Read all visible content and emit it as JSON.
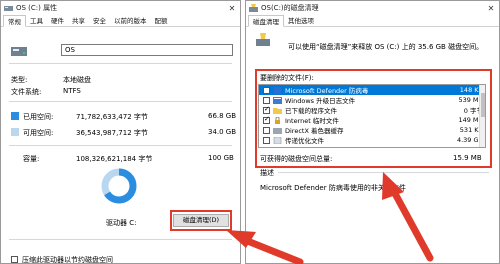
{
  "props": {
    "title": "OS (C:) 属性",
    "tabs": [
      "常规",
      "工具",
      "硬件",
      "共享",
      "安全",
      "以前的版本",
      "配额"
    ],
    "name": "OS",
    "type_label": "类型:",
    "type_value": "本地磁盘",
    "fs_label": "文件系统:",
    "fs_value": "NTFS",
    "used_label": "已用空间:",
    "used_bytes": "71,782,633,472 字节",
    "used_gb": "66.8 GB",
    "free_label": "可用空间:",
    "free_bytes": "36,543,987,712 字节",
    "free_gb": "34.0 GB",
    "cap_label": "容量:",
    "cap_bytes": "108,326,621,184 字节",
    "cap_gb": "100 GB",
    "drive_label": "驱动器 C:",
    "cleanup_button": "磁盘清理(D)",
    "compress_label": "压缩此驱动器以节约磁盘空间",
    "used_fraction": 0.66,
    "colors": {
      "used": "#2a8de0",
      "free": "#b9d8f0"
    }
  },
  "cleanup": {
    "title": "OS(C:)的磁盘清理",
    "tabs": [
      "磁盘清理",
      "其他选项"
    ],
    "intro": "可以使用“磁盘清理”来释放 OS (C:) 上的 35.6 GB 磁盘空间。",
    "files_label": "要删除的文件(F):",
    "items": [
      {
        "label": "Microsoft Defender 防病毒",
        "size": "148 KB",
        "checked": false,
        "selected": true,
        "icon": "defender-icon"
      },
      {
        "label": "Windows 升级日志文件",
        "size": "539 MB",
        "checked": false,
        "selected": false,
        "icon": "log-file-icon"
      },
      {
        "label": "已下载的程序文件",
        "size": "0 字节",
        "checked": true,
        "selected": false,
        "icon": "folder-icon"
      },
      {
        "label": "Internet 临时文件",
        "size": "149 MB",
        "checked": true,
        "selected": false,
        "icon": "lock-icon"
      },
      {
        "label": "DirectX 着色器缓存",
        "size": "531 KB",
        "checked": false,
        "selected": false,
        "icon": "cache-icon"
      },
      {
        "label": "传递优化文件",
        "size": "4.39 GB",
        "checked": false,
        "selected": false,
        "icon": "file-icon"
      }
    ],
    "total_label": "可获得的磁盘空间总量:",
    "total_value": "15.9 MB",
    "desc_label": "描述",
    "desc_text": "Microsoft Defender 防病毒使用的非关键文件"
  }
}
